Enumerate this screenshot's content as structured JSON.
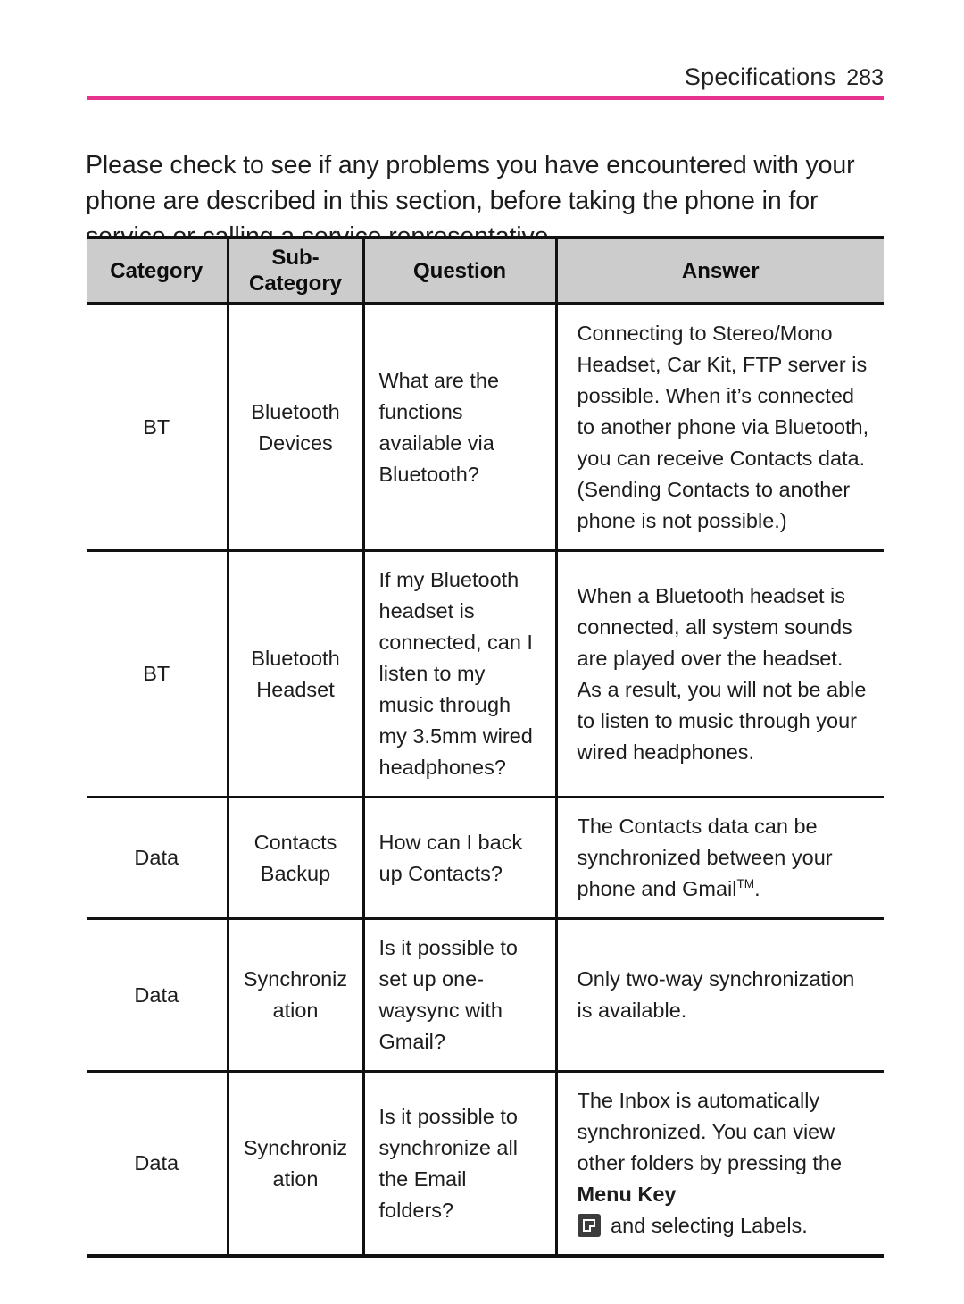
{
  "header": {
    "title": "Specifications",
    "page_number": "283",
    "accent_color": "#e5338e"
  },
  "intro": {
    "text": "Please check to see if any problems you have encountered with your phone are described in this section, before taking the phone in for service or calling a service representative."
  },
  "table": {
    "header_background": "#cccccc",
    "columns": [
      {
        "label": "Category"
      },
      {
        "label": "Sub-\nCategory"
      },
      {
        "label": "Question"
      },
      {
        "label": "Answer"
      }
    ],
    "column_labels": {
      "category": "Category",
      "sub_category_line1": "Sub-",
      "sub_category_line2": "Category",
      "question": "Question",
      "answer": "Answer"
    },
    "rows": [
      {
        "category": "BT",
        "sub_category": "Bluetooth Devices",
        "question": "What are the functions available via Bluetooth?",
        "answer": "Connecting to Stereo/Mono Headset, Car Kit, FTP server is possible. When it’s connected to another phone via Bluetooth, you can receive Contacts data. (Sending Contacts to another phone is not possible.)"
      },
      {
        "category": "BT",
        "sub_category": "Bluetooth Headset",
        "question": "If my Bluetooth headset is connected, can I listen to my music through my 3.5mm wired headphones?",
        "answer": "When a Bluetooth headset is connected, all system sounds are played over the headset. As a result, you will not be able to listen to music through your wired headphones."
      },
      {
        "category": "Data",
        "sub_category": "Contacts Backup",
        "question": "How can I back up Contacts?",
        "answer_prefix": "The Contacts data can be synchronized between your phone and Gmail",
        "answer_superscript": "TM",
        "answer_suffix": "."
      },
      {
        "category": "Data",
        "sub_category": "Synchroniz ation",
        "question": "Is it possible to set up one- waysync with Gmail?",
        "answer": "Only two-way synchronization is available."
      },
      {
        "category": "Data",
        "sub_category": "Synchroniz ation",
        "question": "Is it possible to synchronize all the Email folders?",
        "answer_prefix": "The Inbox is automatically synchronized. You can view other folders by pressing the ",
        "answer_bold": "Menu Key",
        "answer_icon": "menu-key-icon",
        "answer_suffix": " and selecting Labels."
      }
    ]
  }
}
